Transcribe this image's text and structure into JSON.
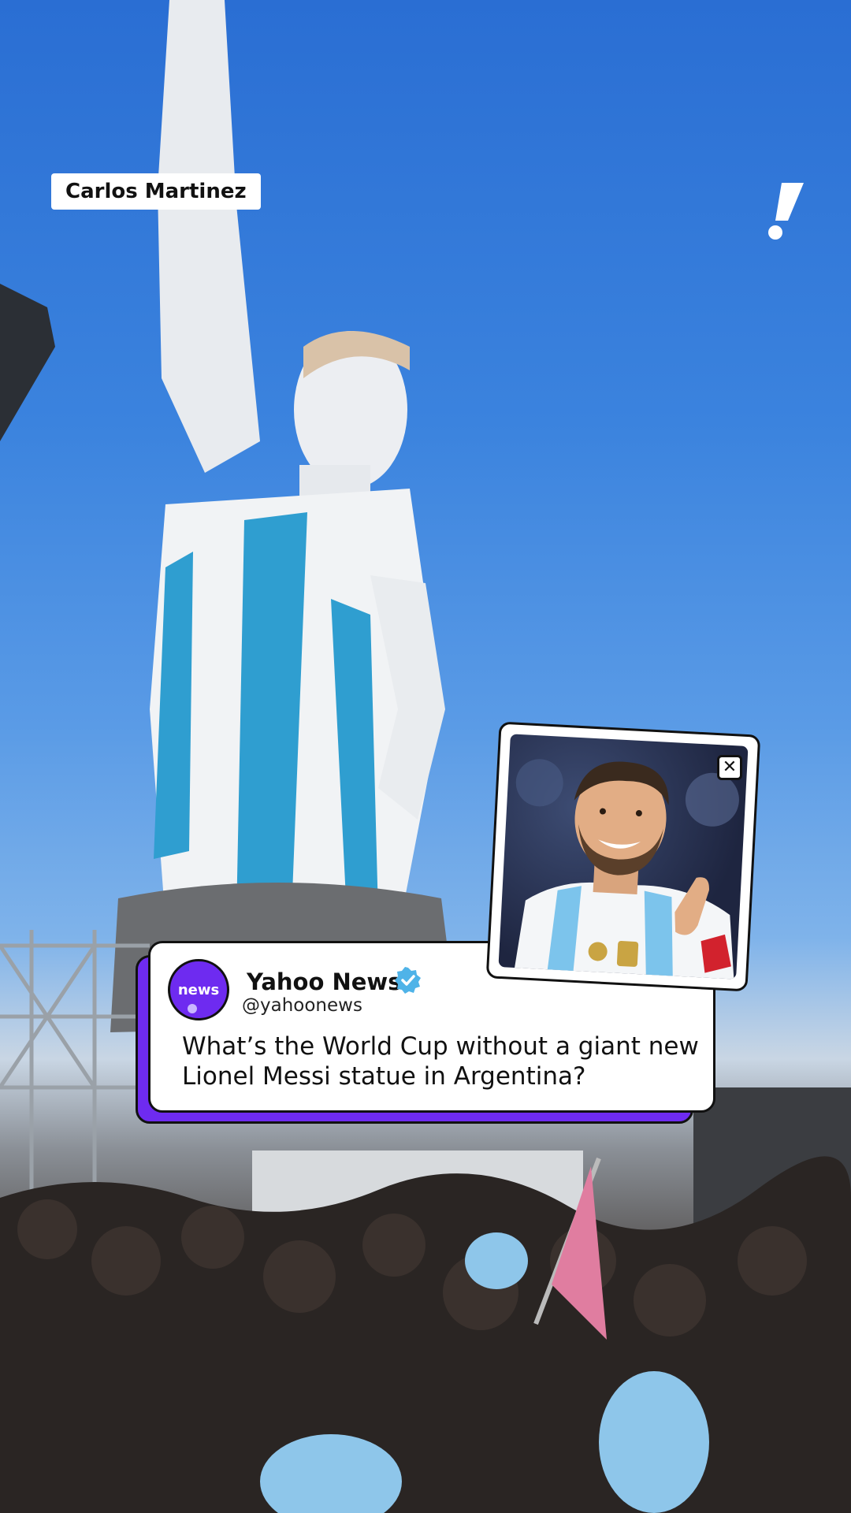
{
  "video": {
    "credit": "Carlos Martinez",
    "brand_icon": "yahoo-exclamation-icon"
  },
  "post": {
    "avatar_label": "news",
    "account_name": "Yahoo News",
    "handle": "@yahoonews",
    "verified_icon": "verified-badge-icon",
    "text": "What’s the World Cup without a giant new Lionel Messi statue in Argentina?"
  },
  "inset": {
    "subject": "player-photo",
    "close_icon": "close-icon"
  },
  "colors": {
    "accent": "#6e2bf0",
    "sky": "#3b83de",
    "verified": "#4fb3e8"
  }
}
